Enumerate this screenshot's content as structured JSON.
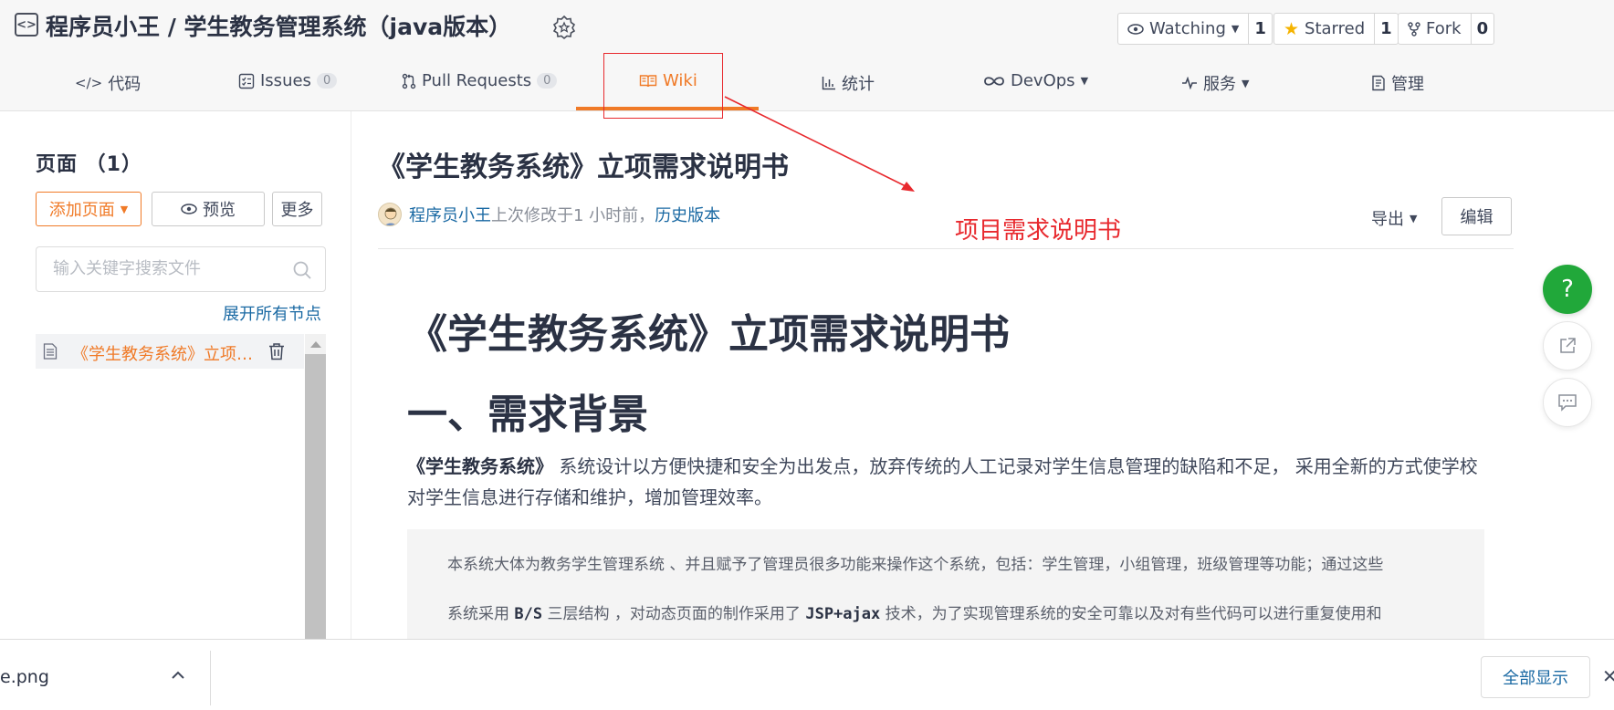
{
  "repo": {
    "title": "程序员小王 / 学生教务管理系统（java版本）"
  },
  "actions": {
    "watching_label": "Watching",
    "watching_count": "1",
    "starred_label": "Starred",
    "starred_count": "1",
    "fork_label": "Fork",
    "fork_count": "0"
  },
  "nav": {
    "code": "代码",
    "issues": "Issues",
    "issues_count": "0",
    "pulls": "Pull Requests",
    "pulls_count": "0",
    "wiki": "Wiki",
    "stats": "统计",
    "devops": "DevOps",
    "services": "服务",
    "manage": "管理",
    "active": "wiki",
    "accent_color": "#f07a27"
  },
  "sidebar": {
    "title": "页面 （1）",
    "add_page": "添加页面",
    "preview": "预览",
    "more": "更多",
    "search_placeholder": "输入关键字搜索文件",
    "expand_all": "展开所有节点",
    "items": [
      {
        "label": "《学生教务系统》立项需求说明书"
      }
    ]
  },
  "doc": {
    "title": "《学生教务系统》立项需求说明书",
    "author": "程序员小王",
    "modified": "上次修改于1 小时前，",
    "history": "历史版本",
    "export": "导出",
    "edit": "编辑"
  },
  "annotation": {
    "text": "项目需求说明书",
    "color": "#e8292e"
  },
  "content": {
    "h1": "《学生教务系统》立项需求说明书",
    "h2": "一、需求背景",
    "para_bold": "《学生教务系统》",
    "para_rest": "系统设计以方便快捷和安全为出发点，放弃传统的人工记录对学生信息管理的缺陷和不足， 采用全新的方式使学校对学生信息进行存储和维护，增加管理效率。",
    "quote_line1": "本系统大体为教务学生管理系统 、并且赋予了管理员很多功能来操作这个系统，包括：学生管理，小组管理，班级管理等功能；通过这些",
    "quote_line2_a": "系统采用 ",
    "quote_line2_code1": "B/S",
    "quote_line2_b": " 三层结构 ，对动态页面的制作采用了 ",
    "quote_line2_code2": "JSP+ajax",
    "quote_line2_c": " 技术，为了实现管理系统的安全可靠以及对有些代码可以进行重复使用和"
  },
  "floating": {
    "help": "?",
    "help_color": "#21a83a"
  },
  "download_bar": {
    "file_name": "e.png",
    "show_all": "全部显示"
  }
}
